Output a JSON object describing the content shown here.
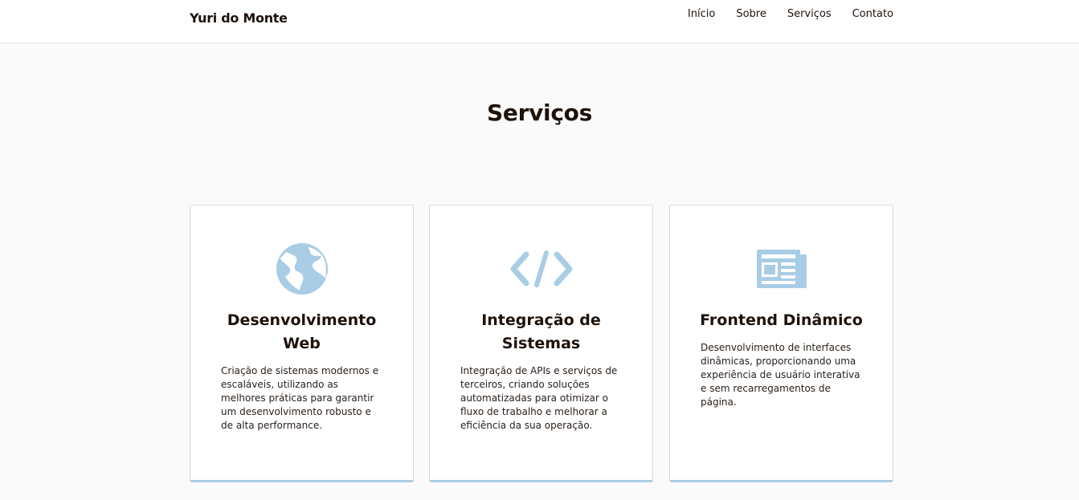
{
  "header": {
    "brand": "Yuri do Monte",
    "nav": [
      "Início",
      "Sobre",
      "Serviços",
      "Contato"
    ]
  },
  "services": {
    "title": "Serviços",
    "cards": [
      {
        "icon": "globe-icon",
        "title": "Desenvolvimento Web",
        "description": "Criação de sistemas modernos e escaláveis, utilizando as melhores práticas para garantir um desenvolvimento robusto e de alta performance."
      },
      {
        "icon": "code-icon",
        "title": "Integração de Sistemas",
        "description": "Integração de APIs e serviços de terceiros, criando soluções automatizadas para otimizar o fluxo de trabalho e melhorar a eficiência da sua operação."
      },
      {
        "icon": "newspaper-icon",
        "title": "Frontend Dinâmico",
        "description": "Desenvolvimento de interfaces dinâmicas, proporcionando uma experiência de usuário interativa e sem recarregamentos de página."
      }
    ]
  },
  "colors": {
    "accent": "#a9cde5",
    "text": "#1d120c",
    "background": "#fafafa"
  }
}
